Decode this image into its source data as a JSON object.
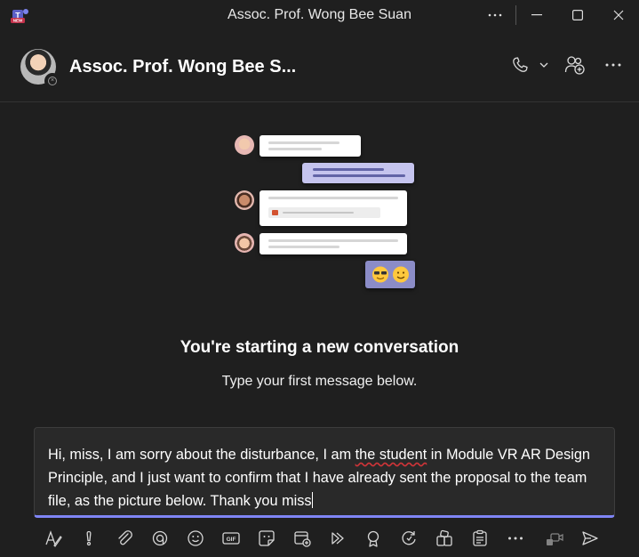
{
  "window": {
    "title": "Assoc. Prof. Wong Bee Suan",
    "app_badge": "NEW",
    "controls": [
      "more",
      "minimize",
      "maximize",
      "close"
    ]
  },
  "header": {
    "contact_name": "Assoc. Prof. Wong Bee S...",
    "presence": "offline",
    "actions": [
      "call-icon",
      "chevron-down-icon",
      "add-people-icon",
      "more-icon"
    ]
  },
  "empty_state": {
    "title": "You're starting a new conversation",
    "subtitle": "Type your first message below."
  },
  "compose": {
    "text_before": "Hi, miss, I am sorry about the disturbance, I am ",
    "text_underlined": "the student",
    "text_after": " in Module VR AR Design Principle, and I just want to confirm that I have already sent the proposal to the team file, as the picture below. Thank you miss"
  },
  "toolbar": {
    "tools": [
      "format-icon",
      "important-icon",
      "attach-icon",
      "loop-icon",
      "emoji-icon",
      "gif-icon",
      "sticker-icon",
      "schedule-meeting-icon",
      "stream-icon",
      "praise-icon",
      "updates-icon",
      "apps-icon",
      "forms-icon",
      "more-options-icon",
      "video-clip-icon",
      "send-icon"
    ],
    "gif_label": "GIF"
  },
  "colors": {
    "background": "#1f1f1f",
    "accent": "#7f85f5",
    "bubble_purple": "#c5c4ee",
    "spell_error": "#d13438"
  }
}
